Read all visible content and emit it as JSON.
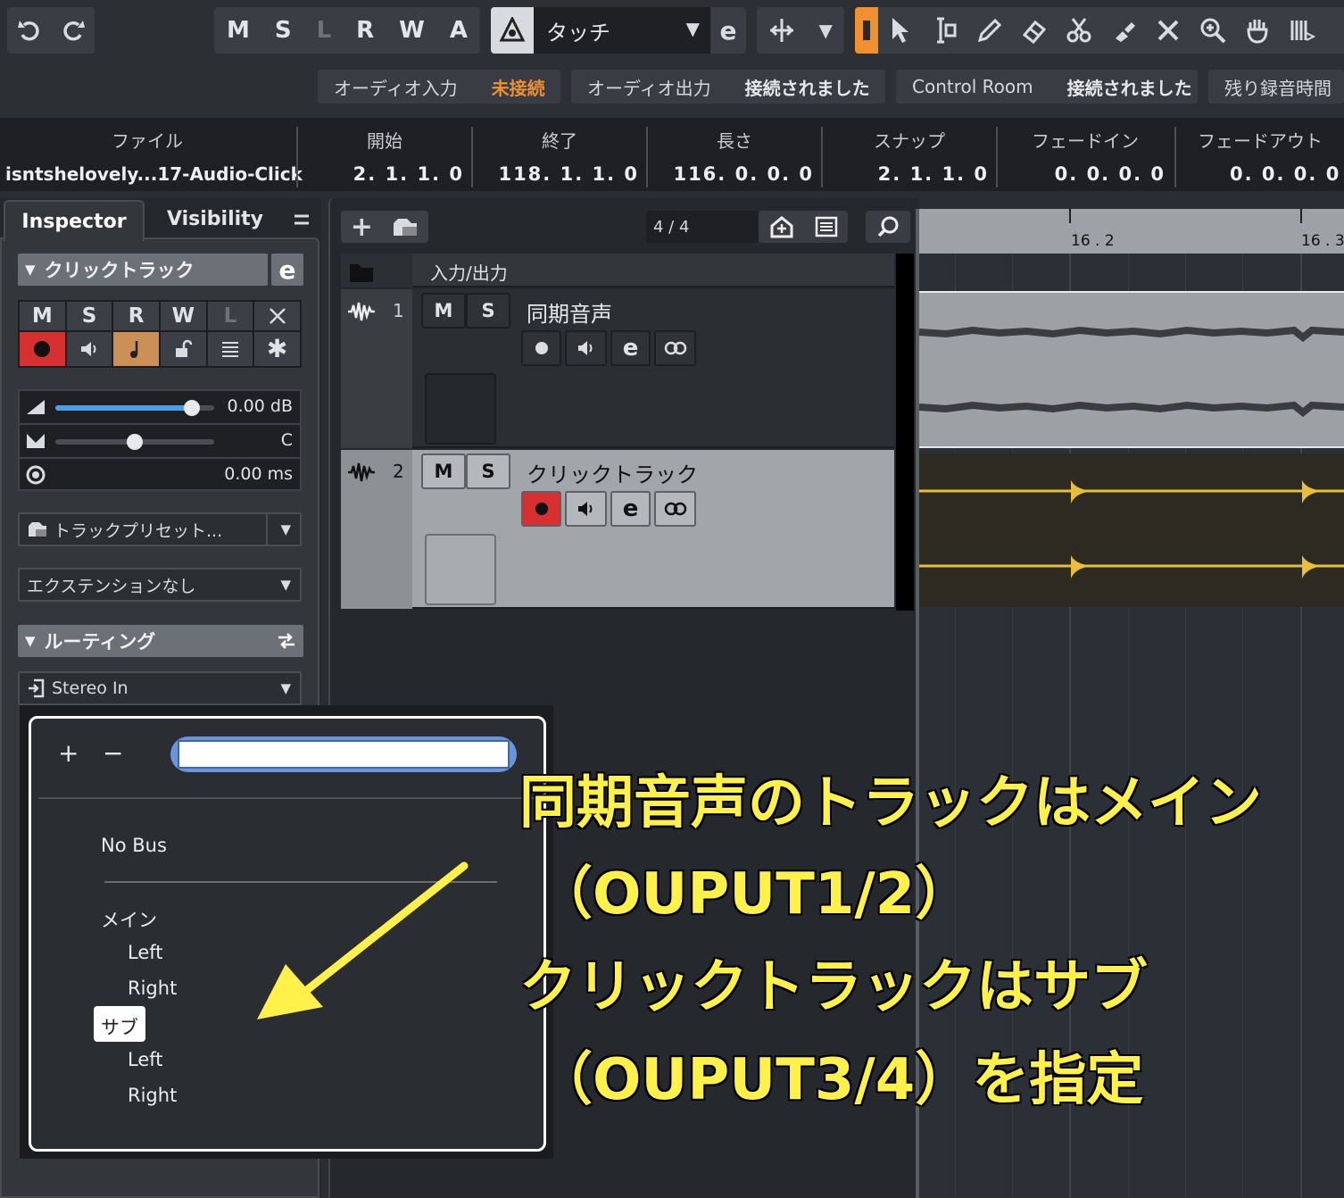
{
  "toolbar": {
    "msrwa": [
      "M",
      "S",
      "L",
      "R",
      "W",
      "A"
    ],
    "automation_mode": "タッチ"
  },
  "connections": [
    {
      "label": "オーディオ入力",
      "status": "未接続"
    },
    {
      "label": "オーディオ出力",
      "status": "接続されました"
    },
    {
      "label": "Control Room",
      "status": "接続されました"
    },
    {
      "label": "残り録音時間",
      "status": ""
    }
  ],
  "info_line": {
    "file": {
      "label": "ファイル",
      "value": "isntshelovely...17-Audio-Click"
    },
    "start": {
      "label": "開始",
      "value": "2. 1. 1.  0"
    },
    "end": {
      "label": "終了",
      "value": "118. 1. 1.  0"
    },
    "length": {
      "label": "長さ",
      "value": "116. 0. 0.  0"
    },
    "snap": {
      "label": "スナップ",
      "value": "2. 1. 1.  0"
    },
    "fade_in": {
      "label": "フェードイン",
      "value": "0. 0. 0.  0"
    },
    "fade_out": {
      "label": "フェードアウト",
      "value": "0. 0. 0.  0"
    }
  },
  "inspector": {
    "tab_inspector": "Inspector",
    "tab_visibility": "Visibility",
    "track_name": "クリックトラック",
    "buttons_row1": [
      "M",
      "S",
      "R",
      "W",
      "L"
    ],
    "volume": "0.00 dB",
    "volume_level": 0.86,
    "pan": "C",
    "pan_level": 0.5,
    "delay": "0.00 ms",
    "track_preset": "トラックプリセット...",
    "extension": "エクステンションなし",
    "routing_title": "ルーティング",
    "input_routing": "Stereo In"
  },
  "track_list": {
    "counter": "4 / 4",
    "folder_name": "入力/出力",
    "tracks": [
      {
        "number": "1",
        "name": "同期音声"
      },
      {
        "number": "2",
        "name": "クリックトラック"
      }
    ],
    "m_label": "M",
    "s_label": "S"
  },
  "ruler": {
    "marks": [
      "16 . 2",
      "16 . 3"
    ]
  },
  "bus_menu": {
    "plus": "+",
    "minus": "−",
    "search_value": "",
    "no_bus": "No Bus",
    "groups": [
      {
        "name": "メイン",
        "channels": [
          "Left",
          "Right"
        ]
      },
      {
        "name": "サブ",
        "channels": [
          "Left",
          "Right"
        ]
      }
    ]
  },
  "annotation": {
    "line1": "同期音声のトラックはメイン",
    "line2": "（OUPUT1/2）",
    "line3": "クリックトラックはサブ",
    "line4": "（OUPUT3/4）を指定",
    "color": "#fff04a"
  }
}
